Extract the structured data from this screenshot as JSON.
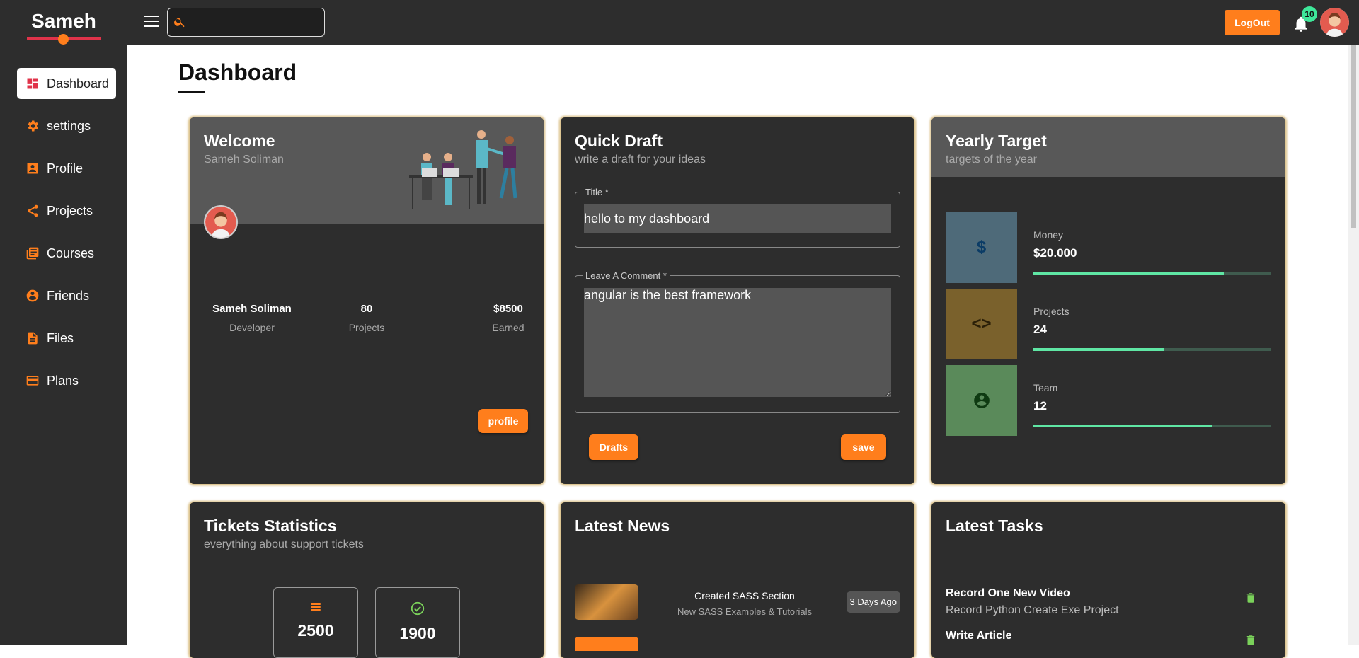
{
  "brand": {
    "name": "Sameh"
  },
  "sidebar": {
    "items": [
      {
        "label": "Dashboard",
        "icon": "dashboard-icon",
        "active": true
      },
      {
        "label": "settings",
        "icon": "gear-icon"
      },
      {
        "label": "Profile",
        "icon": "profile-card-icon"
      },
      {
        "label": "Projects",
        "icon": "share-icon"
      },
      {
        "label": "Courses",
        "icon": "library-icon"
      },
      {
        "label": "Friends",
        "icon": "account-circle-icon"
      },
      {
        "label": "Files",
        "icon": "file-icon"
      },
      {
        "label": "Plans",
        "icon": "credit-card-icon"
      }
    ]
  },
  "header": {
    "search_value": "",
    "logout_label": "LogOut",
    "notification_count": "10"
  },
  "page": {
    "title": "Dashboard"
  },
  "welcome": {
    "title": "Welcome",
    "subtitle": "Sameh Soliman",
    "stats": [
      {
        "value": "Sameh Soliman",
        "label": "Developer"
      },
      {
        "value": "80",
        "label": "Projects"
      },
      {
        "value": "$8500",
        "label": "Earned"
      }
    ],
    "button_label": "profile"
  },
  "quick_draft": {
    "title": "Quick Draft",
    "subtitle": "write a draft for your ideas",
    "title_field_label": "Title *",
    "title_field_value": "hello to my dashboard",
    "comment_field_label": "Leave A Comment *",
    "comment_field_value": "angular is the best framework",
    "drafts_label": "Drafts",
    "save_label": "save"
  },
  "yearly_target": {
    "title": "Yearly Target",
    "subtitle": "targets of the year",
    "items": [
      {
        "label": "Money",
        "value": "$20.000",
        "progress": 0.8,
        "icon": "dollar-icon",
        "bg": "#4e6a79",
        "color": "#0b3c66"
      },
      {
        "label": "Projects",
        "value": "24",
        "progress": 0.55,
        "icon": "code-icon",
        "bg": "#7a612c",
        "color": "#2a1f08"
      },
      {
        "label": "Team",
        "value": "12",
        "progress": 0.75,
        "icon": "account-circle-icon",
        "bg": "#5a8a5a",
        "color": "#0f3a12"
      }
    ]
  },
  "tickets": {
    "title": "Tickets Statistics",
    "subtitle": "everything about support tickets",
    "boxes": [
      {
        "value": "2500",
        "icon": "list-icon"
      },
      {
        "value": "1900",
        "icon": "check-circle-icon"
      }
    ]
  },
  "news": {
    "title": "Latest News",
    "items": [
      {
        "title": "Created SASS Section",
        "subtitle": "New SASS Examples & Tutorials",
        "date": "3 Days Ago"
      }
    ]
  },
  "tasks": {
    "title": "Latest Tasks",
    "items": [
      {
        "title": "Record One New Video",
        "subtitle": "Record Python Create Exe Project"
      },
      {
        "title": "Write Article",
        "subtitle": ""
      }
    ]
  },
  "colors": {
    "accent": "#ff7e1c",
    "sidebar": "#2d2d2d",
    "brand_red": "#e0334a",
    "progress": "#5fe6a4",
    "badge": "#3ee89a"
  }
}
